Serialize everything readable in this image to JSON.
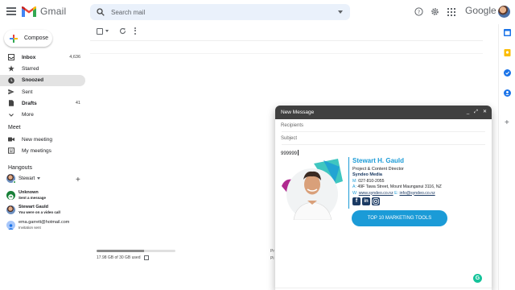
{
  "app": {
    "name": "Gmail",
    "brand": "Google"
  },
  "search": {
    "placeholder": "Search mail"
  },
  "sidebar": {
    "compose_label": "Compose",
    "items": [
      {
        "label": "Inbox",
        "count": "4,636",
        "icon": "inbox-icon"
      },
      {
        "label": "Starred",
        "count": "",
        "icon": "star-icon"
      },
      {
        "label": "Snoozed",
        "count": "",
        "icon": "clock-icon",
        "active": true
      },
      {
        "label": "Sent",
        "count": "",
        "icon": "send-icon"
      },
      {
        "label": "Drafts",
        "count": "41",
        "icon": "draft-icon"
      },
      {
        "label": "More",
        "count": "",
        "icon": "chevron-down-icon"
      }
    ],
    "meet": {
      "title": "Meet",
      "new_meeting": "New meeting",
      "my_meetings": "My meetings"
    },
    "hangouts": {
      "title": "Hangouts",
      "self_name": "Stewart",
      "contacts": [
        {
          "name": "Unknown",
          "subtitle": "Sent a message"
        },
        {
          "name": "Stewart Gauld",
          "subtitle": "You were on a video call"
        },
        {
          "name": "ema.garrett@hotmail.com",
          "subtitle": "Invitation sent"
        }
      ]
    }
  },
  "main": {
    "storage_text": "17.98 GB of 30 GB used",
    "storage_fraction": 0.6,
    "program_fragment_1": "Pr",
    "program_fragment_2": "Pi"
  },
  "compose": {
    "title": "New Message",
    "recipients_placeholder": "Recipients",
    "subject_placeholder": "Subject",
    "body_text": "999999",
    "signature": {
      "name": "Stewart H. Gauld",
      "title": "Project & Content Director",
      "company": "Syndeo Media",
      "phone_label": "M:",
      "phone": "027-810-2055",
      "address_label": "A:",
      "address": "49F Tawa Street,  Mount Maunganui 3116, NZ",
      "web_label": "W:",
      "web": "www.syndeo.co.nz",
      "email_label": "E:",
      "email": "info@syndeo.co.nz",
      "cta": "TOP 10 MARKETING TOOLS"
    }
  },
  "colors": {
    "accent": "#1b9bd7",
    "compose_header": "#404040",
    "search_bg": "#eaf1fb",
    "active_nav": "#e3e3e3"
  }
}
